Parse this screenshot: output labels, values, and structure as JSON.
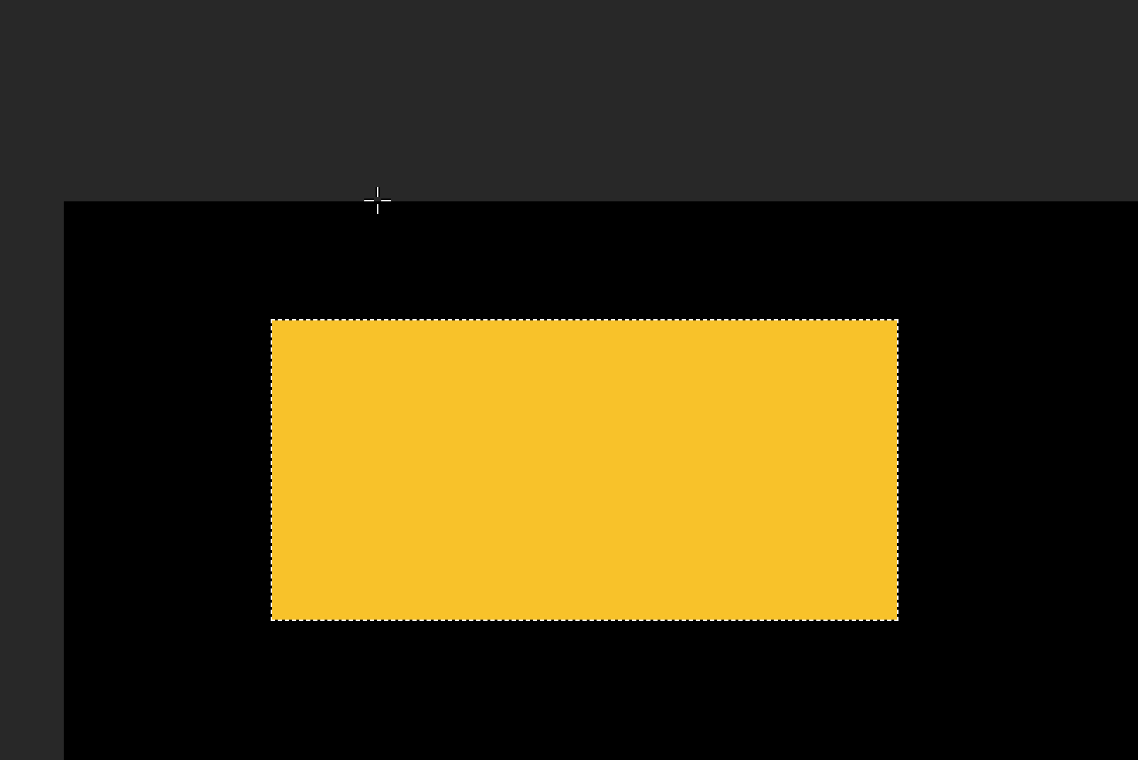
{
  "canvas": {
    "selection": {
      "marquee": true
    },
    "cursor": {
      "kind": "crosshair"
    }
  }
}
